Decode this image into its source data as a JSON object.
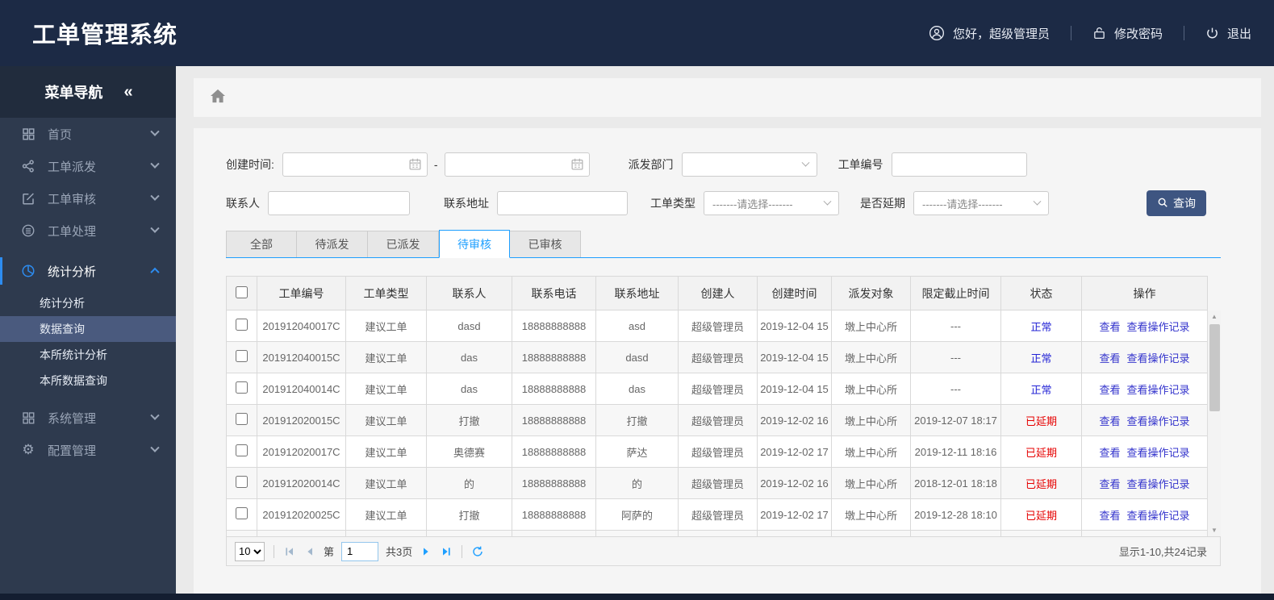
{
  "colors": {
    "header_bg": "#1c2a45",
    "sidebar_bg": "#2e3a4e",
    "accent_blue": "#1E9FFF",
    "menu_accent": "#2d8cf0",
    "button_bg": "#3e5581",
    "link_color": "#3333cc",
    "status_normal": "#2424d6",
    "status_delayed": "#e60000"
  },
  "header": {
    "title": "工单管理系统",
    "greeting": "您好，超级管理员",
    "change_password": "修改密码",
    "logout": "退出"
  },
  "sidebar": {
    "nav_title": "菜单导航",
    "collapse_glyph": "«",
    "items": [
      {
        "key": "home",
        "label": "首页",
        "icon": "grid-icon"
      },
      {
        "key": "dispatch",
        "label": "工单派发",
        "icon": "share-icon"
      },
      {
        "key": "audit",
        "label": "工单审核",
        "icon": "edit-icon"
      },
      {
        "key": "process",
        "label": "工单处理",
        "icon": "process-icon"
      },
      {
        "key": "stats",
        "label": "统计分析",
        "icon": "pie-chart-icon",
        "active": true
      },
      {
        "key": "system",
        "label": "系统管理",
        "icon": "modules-icon"
      },
      {
        "key": "config",
        "label": "配置管理",
        "icon": "gear-icon"
      }
    ],
    "submenu": [
      "统计分析",
      "数据查询",
      "本所统计分析",
      "本所数据查询"
    ],
    "selected_submenu": "数据查询"
  },
  "filters": {
    "create_time_label": "创建时间:",
    "range_separator": "-",
    "dispatch_dept_label": "派发部门",
    "dispatch_dept_value": "",
    "order_no_label": "工单编号",
    "contact_label": "联系人",
    "address_label": "联系地址",
    "order_type_label": "工单类型",
    "order_type_value": "-------请选择-------",
    "delay_label": "是否延期",
    "delay_value": "-------请选择-------",
    "search_button": "查询"
  },
  "tabs": [
    {
      "key": "all",
      "label": "全部"
    },
    {
      "key": "to-dispatch",
      "label": "待派发"
    },
    {
      "key": "dispatched",
      "label": "已派发"
    },
    {
      "key": "to-audit",
      "label": "待审核",
      "active": true
    },
    {
      "key": "audited",
      "label": "已审核"
    }
  ],
  "table": {
    "columns": [
      "工单编号",
      "工单类型",
      "联系人",
      "联系电话",
      "联系地址",
      "创建人",
      "创建时间",
      "派发对象",
      "限定截止时间",
      "状态",
      "操作"
    ],
    "action_labels": [
      "查看",
      "查看操作记录"
    ],
    "rows": [
      {
        "order_no": "201912040017C",
        "type": "建议工单",
        "contact": "dasd",
        "phone": "18888888888",
        "address": "asd",
        "creator": "超级管理员",
        "created": "2019-12-04 15",
        "target": "墩上中心所",
        "deadline": "---",
        "status": "正常",
        "status_type": "normal"
      },
      {
        "order_no": "201912040015C",
        "type": "建议工单",
        "contact": "das",
        "phone": "18888888888",
        "address": "dasd",
        "creator": "超级管理员",
        "created": "2019-12-04 15",
        "target": "墩上中心所",
        "deadline": "---",
        "status": "正常",
        "status_type": "normal"
      },
      {
        "order_no": "201912040014C",
        "type": "建议工单",
        "contact": "das",
        "phone": "18888888888",
        "address": "das",
        "creator": "超级管理员",
        "created": "2019-12-04 15",
        "target": "墩上中心所",
        "deadline": "---",
        "status": "正常",
        "status_type": "normal"
      },
      {
        "order_no": "201912020015C",
        "type": "建议工单",
        "contact": "打撤",
        "phone": "18888888888",
        "address": "打撤",
        "creator": "超级管理员",
        "created": "2019-12-02 16",
        "target": "墩上中心所",
        "deadline": "2019-12-07 18:17",
        "status": "已延期",
        "status_type": "delayed"
      },
      {
        "order_no": "201912020017C",
        "type": "建议工单",
        "contact": "奥德赛",
        "phone": "18888888888",
        "address": "萨达",
        "creator": "超级管理员",
        "created": "2019-12-02 17",
        "target": "墩上中心所",
        "deadline": "2019-12-11 18:16",
        "status": "已延期",
        "status_type": "delayed"
      },
      {
        "order_no": "201912020014C",
        "type": "建议工单",
        "contact": "的",
        "phone": "18888888888",
        "address": "的",
        "creator": "超级管理员",
        "created": "2019-12-02 16",
        "target": "墩上中心所",
        "deadline": "2018-12-01 18:18",
        "status": "已延期",
        "status_type": "delayed"
      },
      {
        "order_no": "201912020025C",
        "type": "建议工单",
        "contact": "打撤",
        "phone": "18888888888",
        "address": "阿萨的",
        "creator": "超级管理员",
        "created": "2019-12-02 17",
        "target": "墩上中心所",
        "deadline": "2019-12-28 18:10",
        "status": "已延期",
        "status_type": "delayed"
      }
    ]
  },
  "pagination": {
    "page_size": "10",
    "page_prefix": "第",
    "current_page": "1",
    "total_pages_label": "共3页",
    "summary": "显示1-10,共24记录"
  }
}
